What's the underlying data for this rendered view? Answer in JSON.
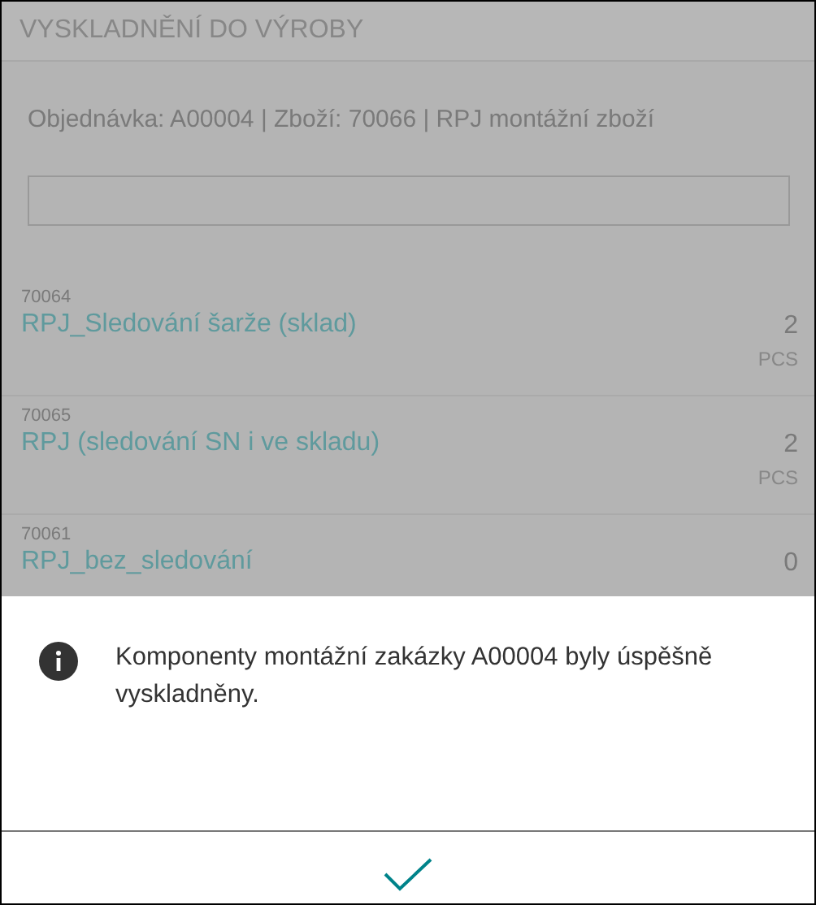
{
  "header": {
    "title": "VYSKLADNĚNÍ DO VÝROBY"
  },
  "order_info": "Objednávka: A00004 | Zboží: 70066 | RPJ montážní zboží",
  "items": [
    {
      "code": "70064",
      "name": "RPJ_Sledování šarže (sklad)",
      "quantity": "2",
      "unit": "PCS"
    },
    {
      "code": "70065",
      "name": "RPJ (sledování SN i ve skladu)",
      "quantity": "2",
      "unit": "PCS"
    },
    {
      "code": "70061",
      "name": "RPJ_bez_sledování",
      "quantity": "0"
    }
  ],
  "dialog": {
    "kind": "info",
    "message": "Komponenty montážní zakázky A00004 byly úspěšně vyskladněny."
  }
}
